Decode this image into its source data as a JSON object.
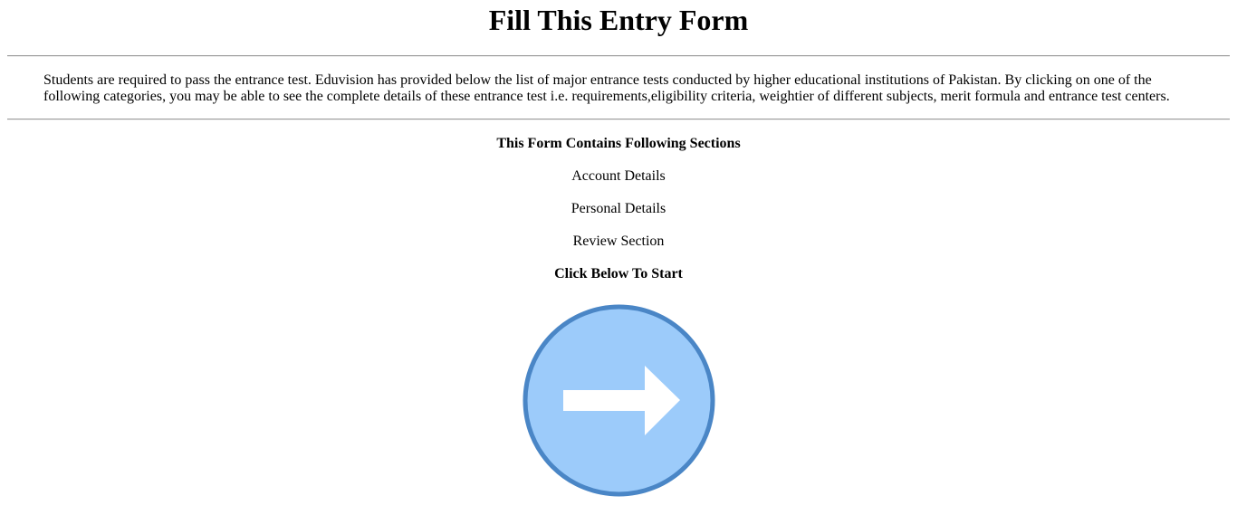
{
  "page": {
    "title": "Fill This Entry Form",
    "intro": "Students are required to pass the entrance test. Eduvision has provided below the list of major entrance tests conducted by higher educational institutions of Pakistan. By clicking on one of the following categories, you may be able to see the complete details of these entrance test i.e. requirements,eligibility criteria, weightier of different subjects, merit formula and entrance test centers."
  },
  "sections": {
    "heading": "This Form Contains Following Sections",
    "items": [
      "Account Details",
      "Personal Details",
      "Review Section"
    ],
    "cta": "Click Below To Start"
  },
  "start_button": {
    "icon": "arrow-right-icon",
    "colors": {
      "fill": "#9ccbfa",
      "border": "#4a86c6",
      "arrow": "#ffffff"
    }
  }
}
